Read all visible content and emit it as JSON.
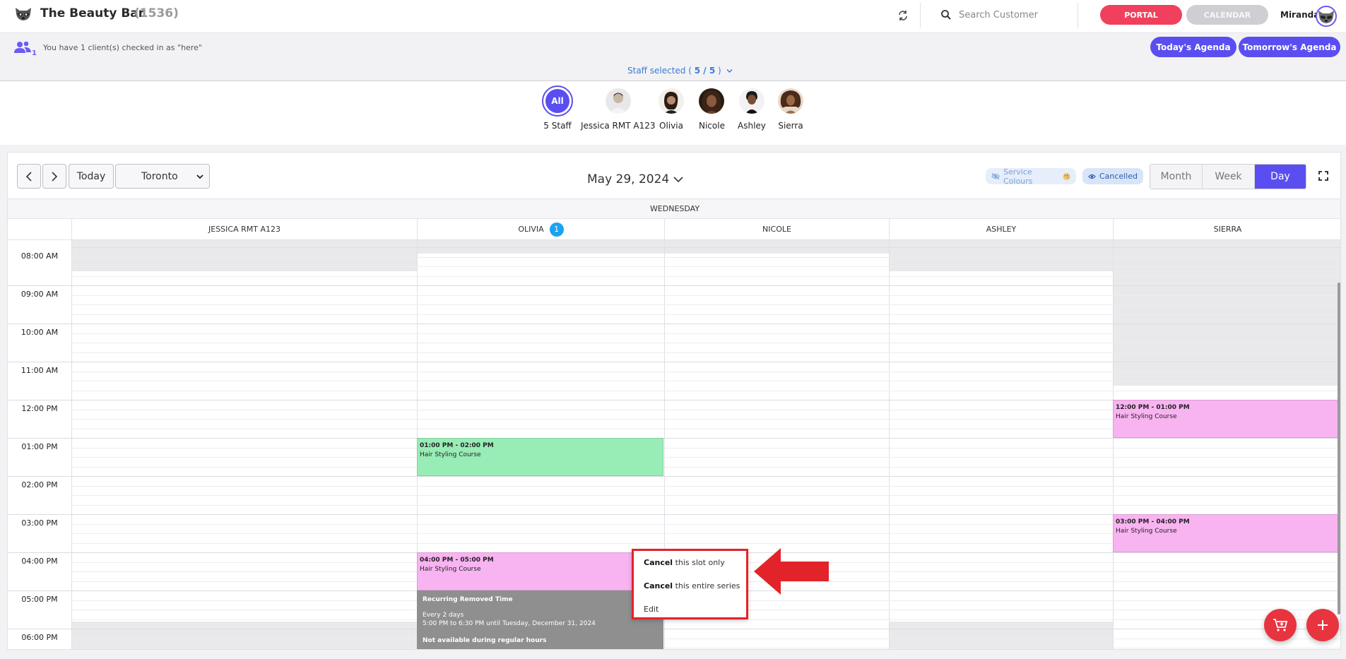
{
  "header": {
    "brand_name": "The Beauty Bar",
    "brand_count": "(1536)",
    "search_placeholder": "Search Customer",
    "portal_label": "PORTAL",
    "calendar_label": "CALENDAR",
    "user_name": "Miranda"
  },
  "checkin": {
    "count": "1",
    "message": "You have 1 client(s) checked in as \"here\""
  },
  "agenda": {
    "today_label": "Today's Agenda",
    "tomorrow_label": "Tomorrow's Agenda"
  },
  "staff_selector": {
    "prefix": "Staff selected (",
    "count": "5 / 5",
    "suffix": ")"
  },
  "staff": [
    {
      "label": "5 Staff",
      "avatar_text": "All"
    },
    {
      "label": "Jessica RMT A123"
    },
    {
      "label": "Olivia"
    },
    {
      "label": "Nicole"
    },
    {
      "label": "Ashley"
    },
    {
      "label": "Sierra"
    }
  ],
  "toolbar": {
    "today_label": "Today",
    "timezone": "Toronto",
    "date_title": "May 29, 2024",
    "service_colours_label": "Service Colours",
    "cancelled_label": "Cancelled",
    "views": [
      "Month",
      "Week",
      "Day"
    ],
    "active_view": "Day"
  },
  "calendar": {
    "weekday": "WEDNESDAY",
    "columns": [
      {
        "name": "JESSICA RMT A123",
        "badge": ""
      },
      {
        "name": "OLIVIA",
        "badge": "1"
      },
      {
        "name": "NICOLE",
        "badge": ""
      },
      {
        "name": "ASHLEY",
        "badge": ""
      },
      {
        "name": "SIERRA",
        "badge": ""
      }
    ],
    "times": [
      "08:00 AM",
      "09:00 AM",
      "10:00 AM",
      "11:00 AM",
      "12:00 PM",
      "01:00 PM",
      "02:00 PM",
      "03:00 PM",
      "04:00 PM",
      "05:00 PM",
      "06:00 PM"
    ],
    "appointments": [
      {
        "staff": "Olivia",
        "time": "01:00 PM - 02:00 PM",
        "service": "Hair Styling Course",
        "color": "#98ecb6"
      },
      {
        "staff": "Olivia",
        "time": "04:00 PM - 05:00 PM",
        "service": "Hair Styling Course",
        "color": "#f8b3f1"
      },
      {
        "staff": "Sierra",
        "time": "12:00 PM - 01:00 PM",
        "service": "Hair Styling Course",
        "color": "#f8b3f1"
      },
      {
        "staff": "Sierra",
        "time": "03:00 PM - 04:00 PM",
        "service": "Hair Styling Course",
        "color": "#f8b3f1"
      }
    ],
    "recurring_block": {
      "title": "Recurring Removed Time",
      "frequency": "Every 2 days",
      "range": "5:00 PM to 6:30 PM until Tuesday, December 31, 2024",
      "footer": "Not available during regular hours"
    }
  },
  "context_menu": {
    "item1_bold": "Cancel",
    "item1_rest": " this slot only",
    "item2_bold": "Cancel",
    "item2_rest": " this entire series",
    "item3": "Edit"
  },
  "colors": {
    "accent": "#5b4ef0",
    "portal": "#f0405d",
    "highlight": "#e3232a"
  }
}
